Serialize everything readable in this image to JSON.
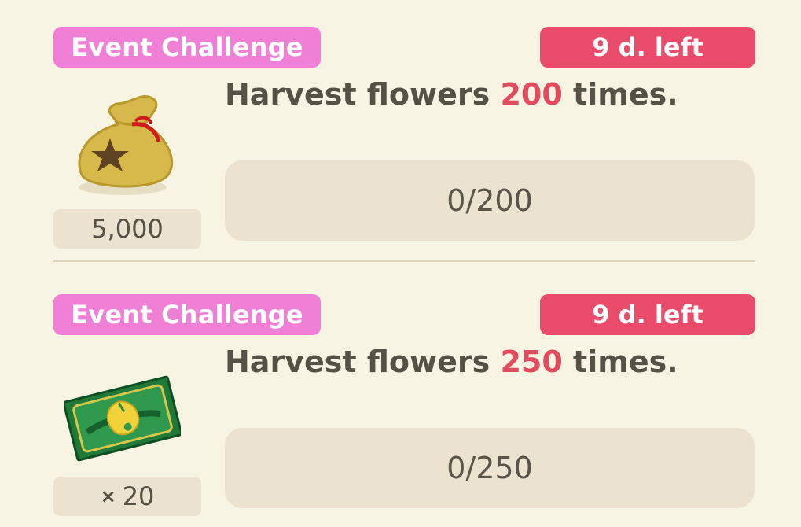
{
  "challenges": [
    {
      "tag": "Event Challenge",
      "time_left": "9 d. left",
      "task_prefix": "Harvest flowers ",
      "task_count": "200",
      "task_suffix": " times.",
      "progress_text": "0/200",
      "progress_fraction": 0,
      "reward_icon": "bells-bag-icon",
      "reward_amount": "5,000"
    },
    {
      "tag": "Event Challenge",
      "time_left": "9 d. left",
      "task_prefix": "Harvest flowers ",
      "task_count": "250",
      "task_suffix": " times.",
      "progress_text": "0/250",
      "progress_fraction": 0,
      "reward_icon": "leaf-ticket-icon",
      "reward_multiplier": "×",
      "reward_amount": "20"
    }
  ],
  "colors": {
    "background": "#f8f4e4",
    "event_tag": "#f07fd6",
    "time_badge": "#e84c6a",
    "highlight_number": "#e04b5e"
  }
}
